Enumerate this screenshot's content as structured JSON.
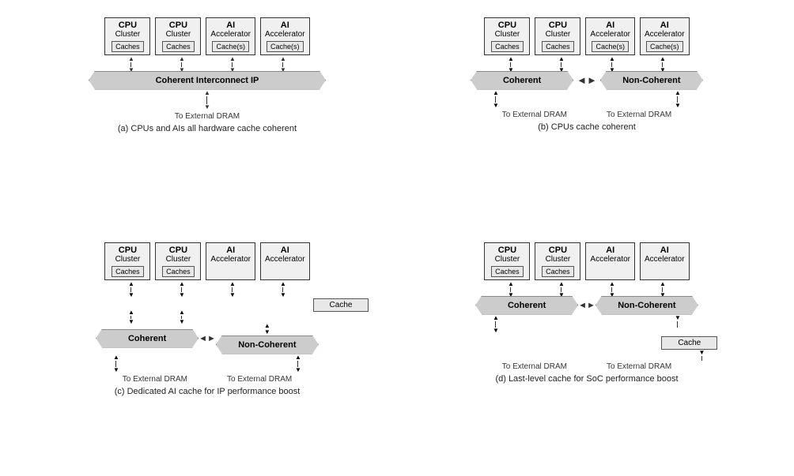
{
  "diagrams": [
    {
      "id": "a",
      "caption": "(a) CPUs and AIs all hardware cache coherent",
      "units": [
        {
          "title": "CPU",
          "sub": "Cluster",
          "cache": "Caches"
        },
        {
          "title": "CPU",
          "sub": "Cluster",
          "cache": "Caches"
        },
        {
          "title": "AI",
          "sub": "Accelerator",
          "cache": "Cache(s)"
        },
        {
          "title": "AI",
          "sub": "Accelerator",
          "cache": "Cache(s)"
        }
      ],
      "interconnect": "Coherent Interconnect IP",
      "dram_labels": [
        "To External DRAM"
      ],
      "layout": "single"
    },
    {
      "id": "b",
      "caption": "(b) CPUs cache coherent",
      "units": [
        {
          "title": "CPU",
          "sub": "Cluster",
          "cache": "Caches"
        },
        {
          "title": "CPU",
          "sub": "Cluster",
          "cache": "Caches"
        },
        {
          "title": "AI",
          "sub": "Accelerator",
          "cache": "Cache(s)"
        },
        {
          "title": "AI",
          "sub": "Accelerator",
          "cache": "Cache(s)"
        }
      ],
      "interconnect_left": "Coherent",
      "interconnect_right": "Non-Coherent",
      "dram_labels": [
        "To External DRAM",
        "To External DRAM"
      ],
      "layout": "split"
    },
    {
      "id": "c",
      "caption": "(c) Dedicated AI cache for IP performance boost",
      "units": [
        {
          "title": "CPU",
          "sub": "Cluster",
          "cache": "Caches"
        },
        {
          "title": "CPU",
          "sub": "Cluster",
          "cache": "Caches"
        },
        {
          "title": "AI",
          "sub": "Accelerator",
          "cache": null
        },
        {
          "title": "AI",
          "sub": "Accelerator",
          "cache": null
        }
      ],
      "extra_cache": "Cache",
      "interconnect_left": "Coherent",
      "interconnect_right": "Non-Coherent",
      "dram_labels": [
        "To External DRAM",
        "To External DRAM"
      ],
      "layout": "split-cache-mid"
    },
    {
      "id": "d",
      "caption": "(d) Last-level cache for SoC performance boost",
      "units": [
        {
          "title": "CPU",
          "sub": "Cluster",
          "cache": "Caches"
        },
        {
          "title": "CPU",
          "sub": "Cluster",
          "cache": "Caches"
        },
        {
          "title": "AI",
          "sub": "Accelerator",
          "cache": null
        },
        {
          "title": "AI",
          "sub": "Accelerator",
          "cache": null
        }
      ],
      "extra_cache_bottom": "Cache",
      "interconnect_left": "Coherent",
      "interconnect_right": "Non-Coherent",
      "dram_labels": [
        "To External DRAM",
        "To External DRAM"
      ],
      "layout": "split-cache-bottom"
    }
  ]
}
